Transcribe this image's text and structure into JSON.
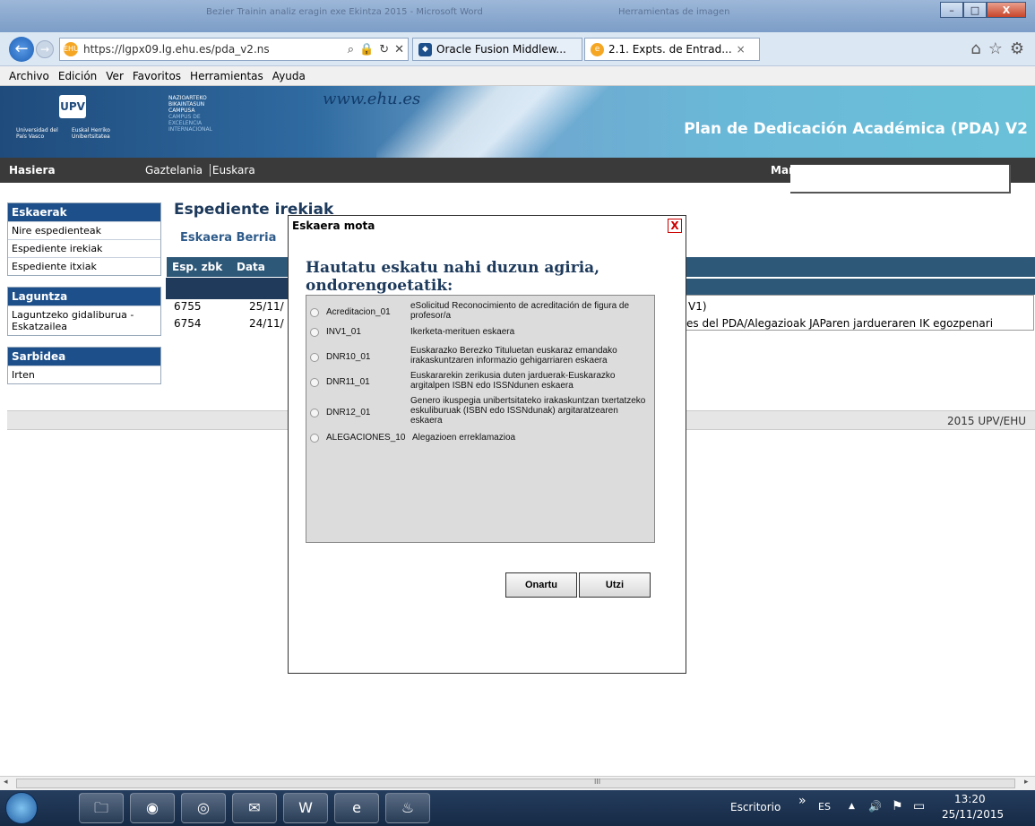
{
  "window": {
    "title": "Bezier Trainin analiz eragin exe Ekintza 2015 - Microsoft Word",
    "title_right": "Herramientas de imagen",
    "minimize": "–",
    "maximize": "□",
    "close": "X"
  },
  "browser": {
    "url": "https://lgpx09.lg.ehu.es/pda_v2.ns",
    "tabs": [
      {
        "label": "Oracle Fusion Middlew...",
        "icon": "oracle-icon"
      },
      {
        "label": "2.1. Expts. de Entrad...",
        "icon": "ehu-icon"
      }
    ],
    "tab_close": "×",
    "menu": [
      "Archivo",
      "Edición",
      "Ver",
      "Favoritos",
      "Herramientas",
      "Ayuda"
    ]
  },
  "banner": {
    "logo_top": "UPV",
    "logo_left": "Universidad del País Vasco",
    "logo_right": "Euskal Herriko Unibertsitatea",
    "campus_lines": [
      "NAZIOARTEKO",
      "BIKAINTASUN",
      "CAMPUSA"
    ],
    "campus_lines_dim": [
      "CAMPUS DE",
      "EXCELENCIA",
      "INTERNACIONAL"
    ],
    "www": "www.ehu.es",
    "title": "Plan de Dedicación Académica (PDA) V2"
  },
  "nav": {
    "home": "Hasiera",
    "lang1": "Gaztelania",
    "lang2": "Euskara",
    "user": "Mar"
  },
  "sidebar": {
    "sections": [
      {
        "header": "Eskaerak",
        "items": [
          "Nire espedienteak",
          "Espediente irekiak",
          "Espediente itxiak"
        ]
      },
      {
        "header": "Laguntza",
        "items": [
          "Laguntzeko gidaliburua - Eskatzailea"
        ]
      },
      {
        "header": "Sarbidea",
        "items": [
          "Irten"
        ]
      }
    ]
  },
  "main": {
    "title": "Espediente irekiak",
    "new_request": "Eskaera Berria",
    "col_espzbk": "Esp. zbk",
    "col_data": "Data",
    "rows": [
      {
        "id": "6755",
        "date": "25/11/",
        "tail": "V1)"
      },
      {
        "id": "6754",
        "date": "24/11/",
        "tail": "es del PDA/Alegazioak JAParen jardueraren IK egozpenari"
      }
    ],
    "footer": "2015 UPV/EHU"
  },
  "modal": {
    "title": "Eskaera mota",
    "close": "X",
    "heading_line1": "Hautatu eskatu nahi duzun agiria,",
    "heading_line2": "ondorengoetatik:",
    "options": [
      {
        "code": "Acreditacion_01",
        "desc": "eSolicitud Reconocimiento de acreditación de figura de profesor/a"
      },
      {
        "code": "INV1_01",
        "desc": "Ikerketa-merituen eskaera"
      },
      {
        "code": "DNR10_01",
        "desc": "Euskarazko Berezko Tituluetan euskaraz emandako irakaskuntzaren informazio gehigarriaren eskaera"
      },
      {
        "code": "DNR11_01",
        "desc": "Euskararekin zerikusia duten jarduerak-Euskarazko argitalpen ISBN edo ISSNdunen eskaera"
      },
      {
        "code": "DNR12_01",
        "desc": "Genero ikuspegia unibertsitateko irakaskuntzan txertatzeko eskuliburuak (ISBN edo ISSNdunak) argitaratzearen eskaera"
      },
      {
        "code": "ALEGACIONES_10",
        "desc": "Alegazioen erreklamazioa"
      }
    ],
    "ok": "Onartu",
    "cancel": "Utzi"
  },
  "scrollbar": {
    "grip": "III",
    "left_arrow": "◂",
    "right_arrow": "▸"
  },
  "taskbar": {
    "apps": [
      "folder-icon",
      "firefox-icon",
      "chrome-icon",
      "mail-icon",
      "word-icon",
      "ie-icon",
      "java-icon"
    ],
    "app_glyphs": [
      "🗀",
      "◉",
      "◎",
      "✉",
      "W",
      "e",
      "♨"
    ],
    "desktop": "Escritorio",
    "chevron": "»",
    "lang": "ES",
    "tray_up": "▲",
    "volume": "🔊",
    "flag": "⚑",
    "network": "▭",
    "time": "13:20",
    "date": "25/11/2015"
  }
}
